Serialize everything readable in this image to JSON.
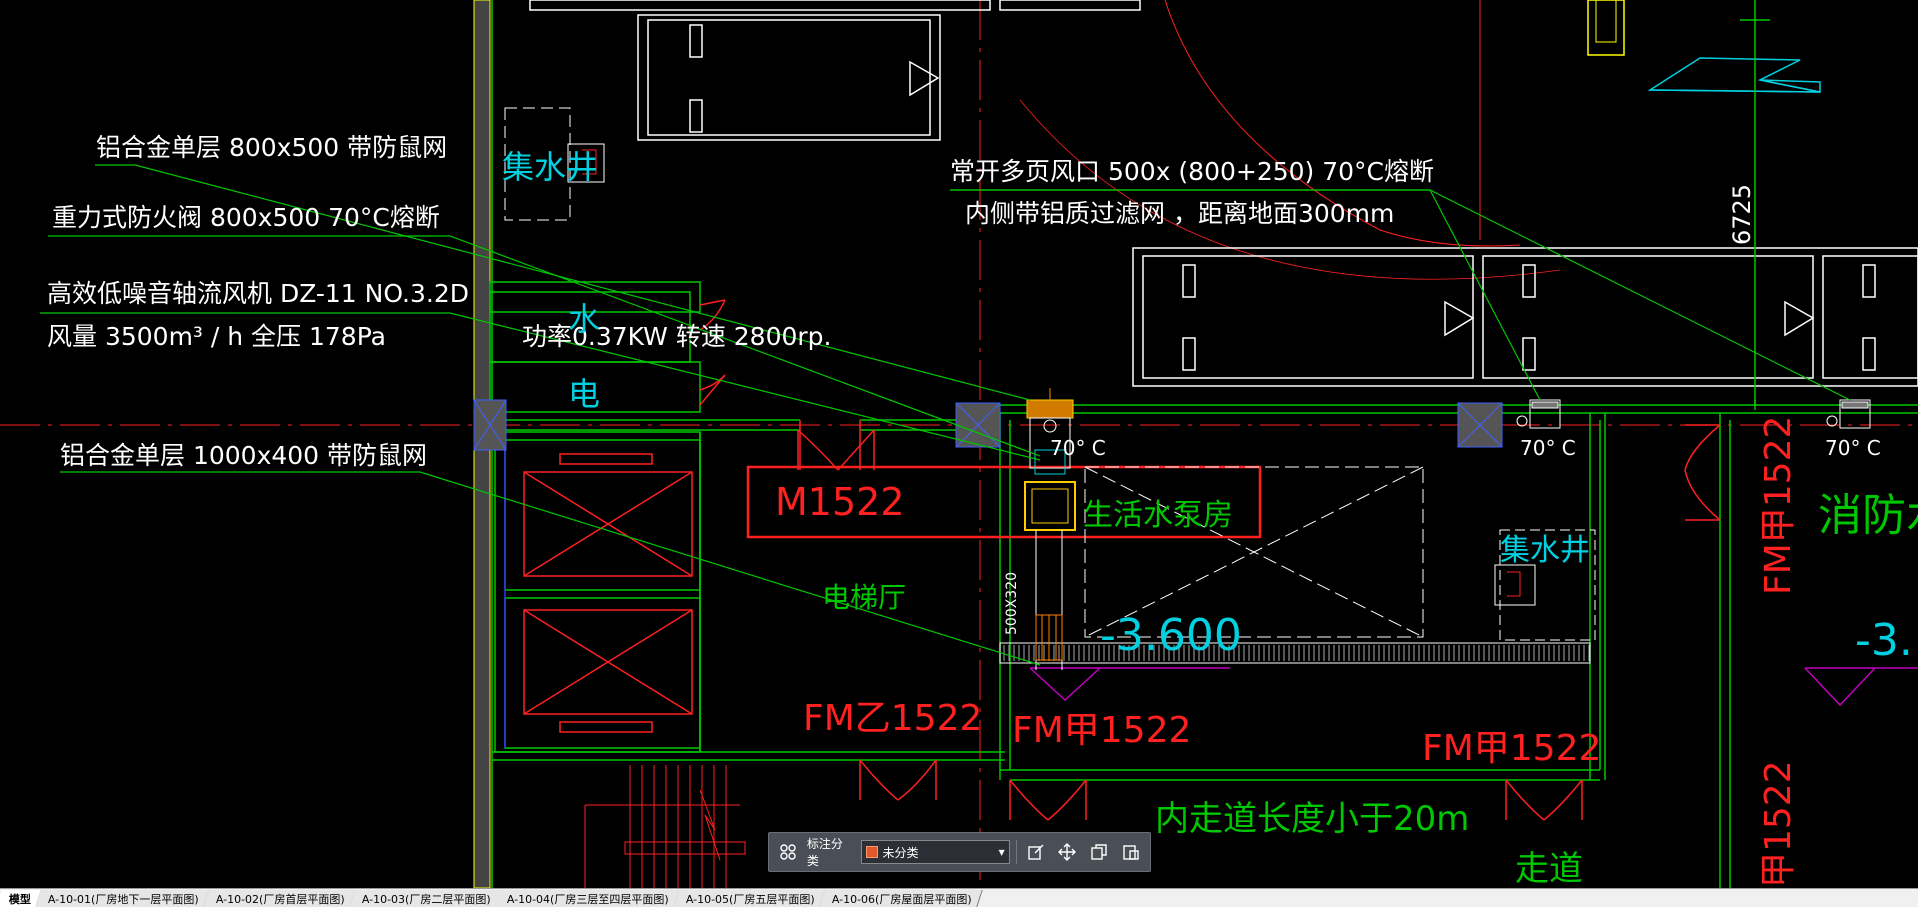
{
  "drawing": {
    "labels": {
      "note1": "铝合金单层 800x500 带防鼠网",
      "note2": "重力式防火阀 800x500 70°C熔断",
      "note3": "高效低噪音轴流风机 DZ-11 NO.3.2D",
      "note4": "风量 3500m³ / h 全压 178Pa",
      "note5": "功率0.37KW 转速 2800rp.",
      "note6": "铝合金单层 1000x400 带防鼠网",
      "note7": "常开多页风口 500x (800+250) 70°C熔断",
      "note8": "内侧带铝质过滤网 ，距离地面300mm",
      "dim1": "6725",
      "sump1": "集水井",
      "sump2": "集水井",
      "water": "水",
      "elec": "电",
      "door_m1522": "M1522",
      "pump_room": "生活水泵房",
      "temp1": "70° C",
      "temp2": "70° C",
      "temp3": "70° C",
      "elevator_hall": "电梯厅",
      "duct_size": "500X320",
      "level1": "-3.600",
      "level2": "-3.",
      "fire_pool": "消防水",
      "door_fmz1": "FM乙1522",
      "door_fmj1": "FM甲1522",
      "door_fmj2": "FM甲1522",
      "door_fmj3": "FM甲1522",
      "door_fmj4": "甲1522",
      "corridor_note": "内走道长度小于20m",
      "walkway": "走道"
    }
  },
  "annotation_toolbar": {
    "category_label": "标注分类",
    "selected_category": "未分类",
    "category_color": "#e2572b",
    "icons": [
      "grid-icon",
      "edit-icon",
      "move-icon",
      "copy-icon",
      "paste-icon"
    ]
  },
  "tabs": [
    {
      "label": "模型",
      "active": true
    },
    {
      "label": "A-10-01(厂房地下一层平面图)",
      "active": false
    },
    {
      "label": "A-10-02(厂房首层平面图)",
      "active": false
    },
    {
      "label": "A-10-03(厂房二层平面图)",
      "active": false
    },
    {
      "label": "A-10-04(厂房三层至四层平面图)",
      "active": false
    },
    {
      "label": "A-10-05(厂房五层平面图)",
      "active": false
    },
    {
      "label": "A-10-06(厂房屋面层平面图)",
      "active": false
    }
  ],
  "colors": {
    "background": "#000000",
    "green": "#00c800",
    "red": "#ff2020",
    "white": "#ffffff",
    "cyan": "#00d0e0",
    "yellow": "#ffff00",
    "magenta": "#c000c0",
    "orange": "#ff8000"
  }
}
